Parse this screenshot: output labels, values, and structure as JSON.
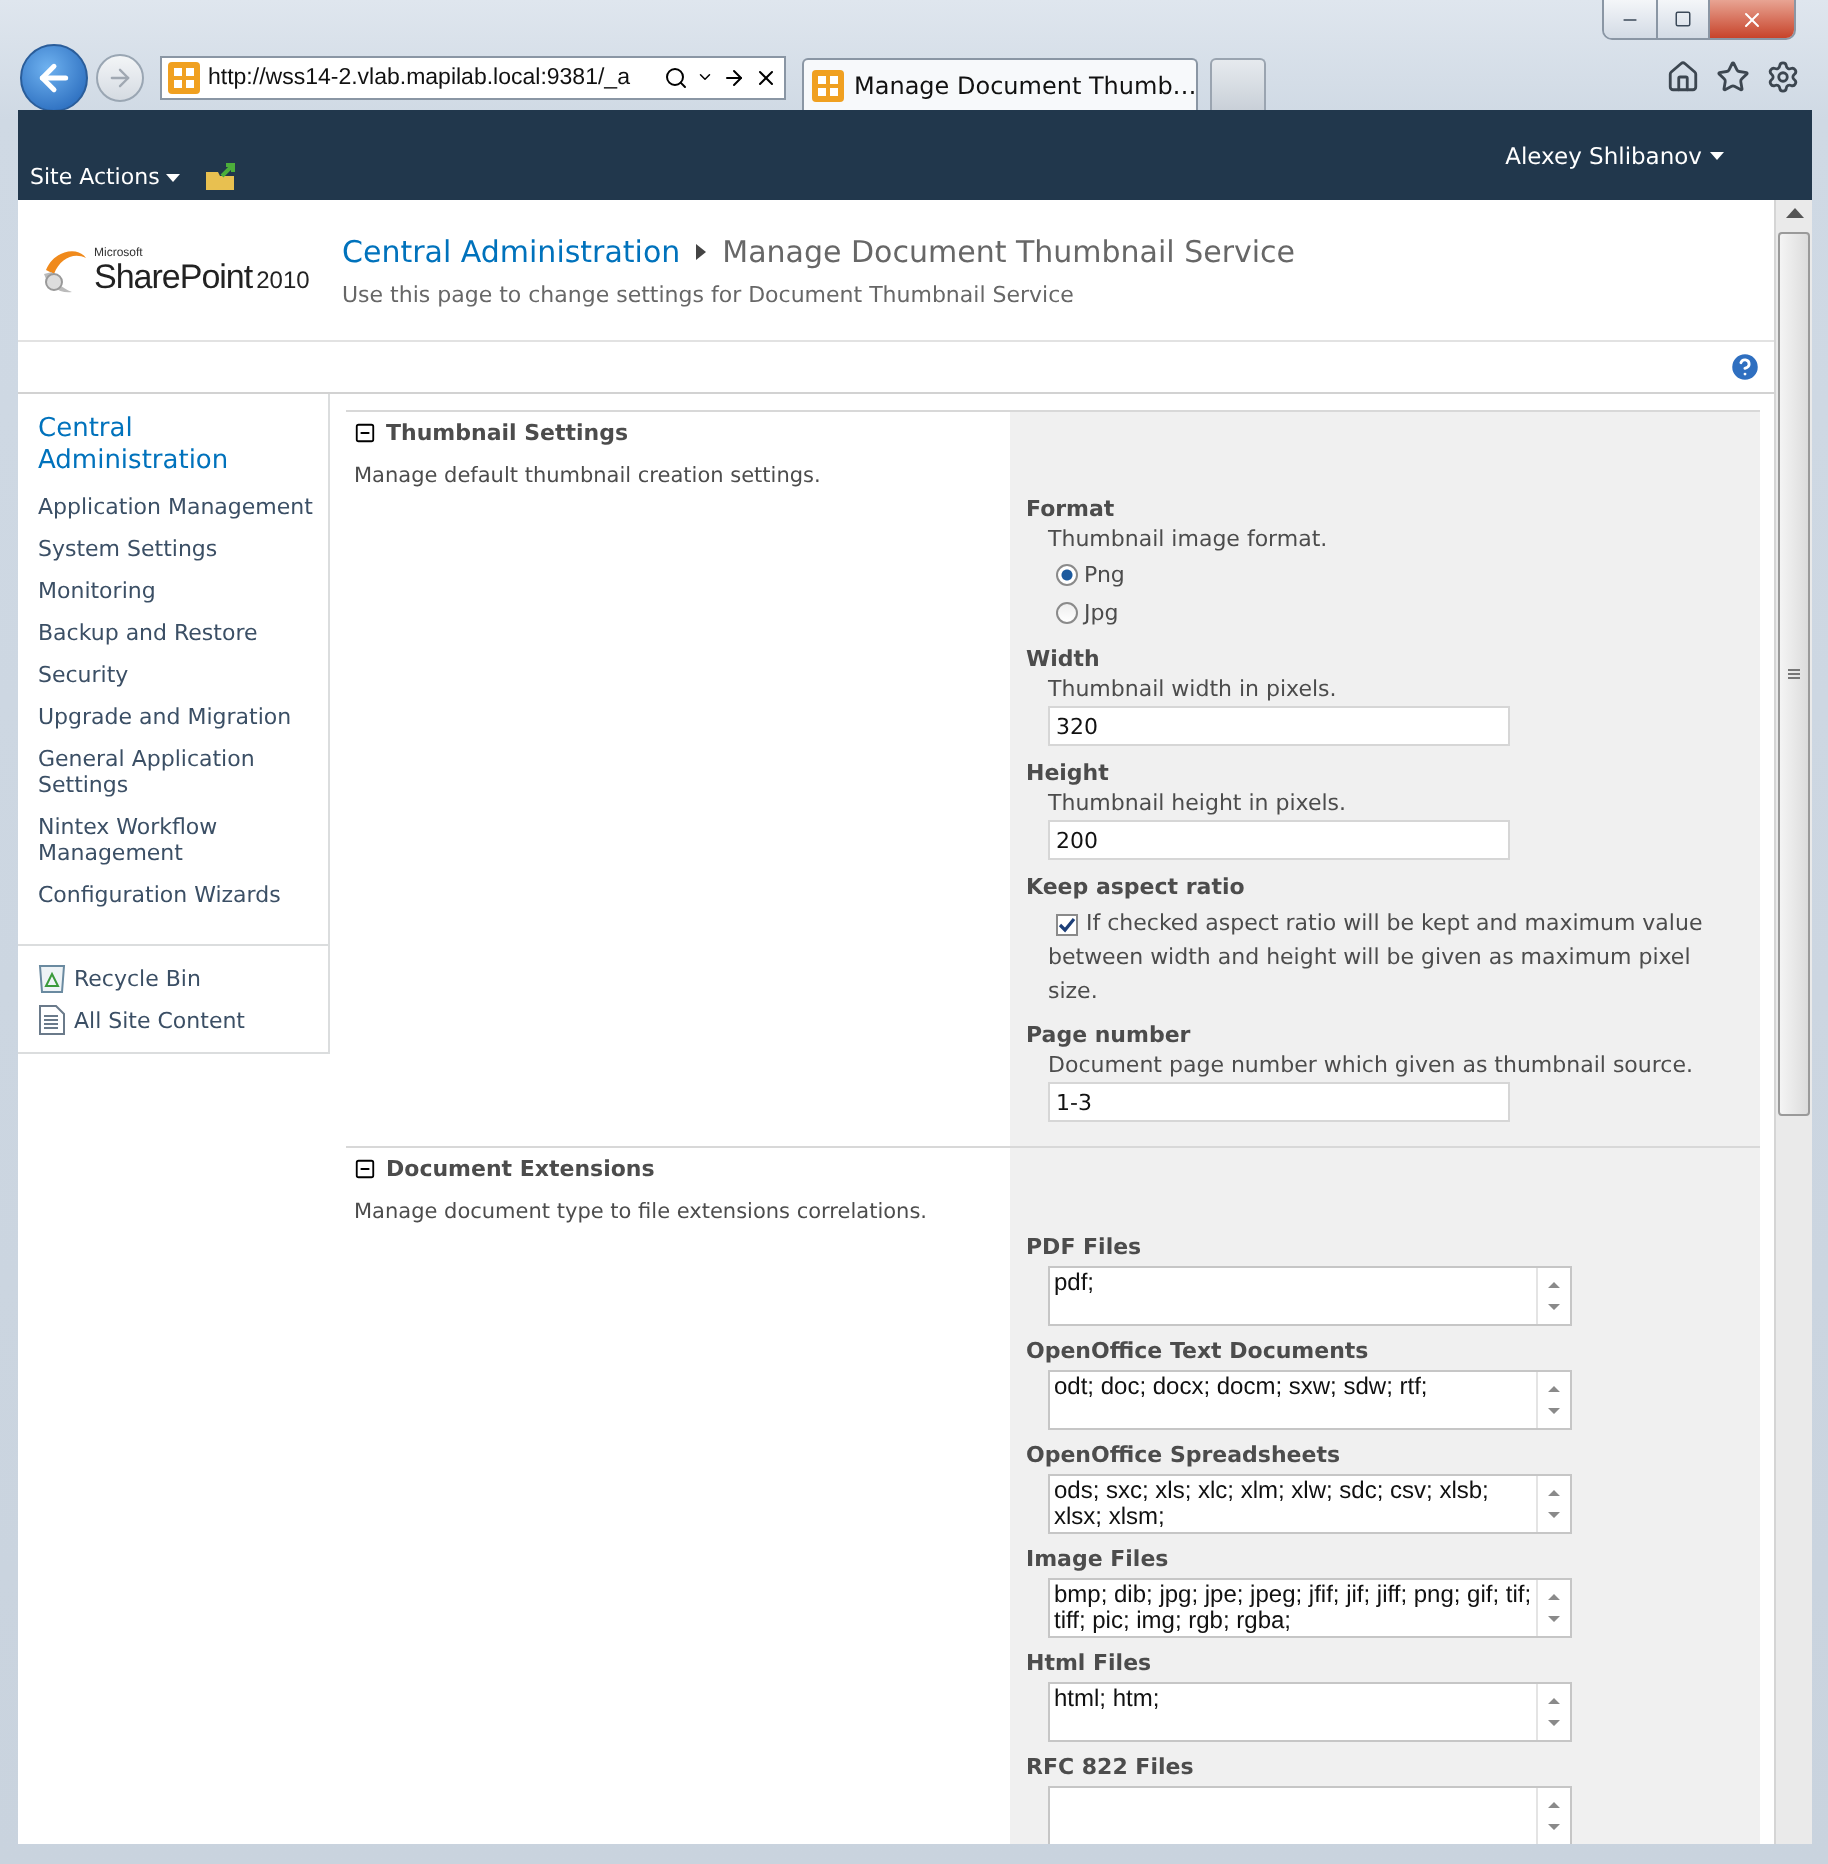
{
  "browser": {
    "address": "http://wss14-2.vlab.mapilab.local:9381/_a",
    "tabs": [
      {
        "label": "Manage Document Thumb…",
        "selected": true
      }
    ]
  },
  "top_bar": {
    "site_actions": "Site Actions",
    "user": "Alexey Shlibanov"
  },
  "header": {
    "logo": {
      "brand": "Microsoft",
      "product": "SharePoint",
      "version": "2010"
    },
    "breadcrumb": [
      "Central Administration",
      "Manage Document Thumbnail Service"
    ],
    "description": "Use this page to change settings for Document Thumbnail Service"
  },
  "nav": {
    "items": [
      {
        "label": "Central Administration",
        "kind": "heading"
      },
      {
        "label": "Application Management",
        "kind": "link"
      },
      {
        "label": "System Settings",
        "kind": "link"
      },
      {
        "label": "Monitoring",
        "kind": "link"
      },
      {
        "label": "Backup and Restore",
        "kind": "link"
      },
      {
        "label": "Security",
        "kind": "link"
      },
      {
        "label": "Upgrade and Migration",
        "kind": "link"
      },
      {
        "label": "General Application Settings",
        "kind": "link"
      },
      {
        "label": "Nintex Workflow Management",
        "kind": "link"
      },
      {
        "label": "Configuration Wizards",
        "kind": "link"
      }
    ],
    "footer_links": [
      "Recycle Bin",
      "All Site Content"
    ]
  },
  "sections": [
    {
      "title": "Thumbnail Settings",
      "description": "Manage default thumbnail creation settings.",
      "fields": [
        {
          "kind": "radio",
          "label": "Format",
          "hint": "Thumbnail image format.",
          "options": [
            {
              "label": "Png",
              "selected": true
            },
            {
              "label": "Jpg",
              "selected": false
            }
          ]
        },
        {
          "kind": "text",
          "label": "Width",
          "hint": "Thumbnail width in pixels.",
          "value": "320"
        },
        {
          "kind": "text",
          "label": "Height",
          "hint": "Thumbnail height in pixels.",
          "value": "200"
        },
        {
          "kind": "checkbox",
          "label": "Keep aspect ratio",
          "text": "If checked aspect ratio will be kept and maximum value between width and height will be given as maximum pixel size.",
          "checked": true
        },
        {
          "kind": "text",
          "label": "Page number",
          "hint": "Document page number which given as thumbnail source.",
          "value": "1-3"
        }
      ]
    },
    {
      "title": "Document Extensions",
      "description": "Manage document type to file extensions correlations.",
      "fields": [
        {
          "kind": "textarea",
          "label": "PDF Files",
          "value": "pdf;"
        },
        {
          "kind": "textarea",
          "label": "OpenOffice Text Documents",
          "value": "odt; doc; docx; docm; sxw; sdw; rtf;"
        },
        {
          "kind": "textarea",
          "label": "OpenOffice Spreadsheets",
          "value": "ods; sxc; xls; xlc; xlm; xlw; sdc; csv; xlsb; xlsx; xlsm;"
        },
        {
          "kind": "textarea",
          "label": "Image Files",
          "value": "bmp; dib; jpg; jpe; jpeg; jfif; jif; jiff; png; gif; tif; tiff; pic; img; rgb; rgba;"
        },
        {
          "kind": "textarea",
          "label": "Html Files",
          "value": "html; htm;"
        },
        {
          "kind": "textarea",
          "label": "RFC 822 Files"
        }
      ]
    }
  ]
}
